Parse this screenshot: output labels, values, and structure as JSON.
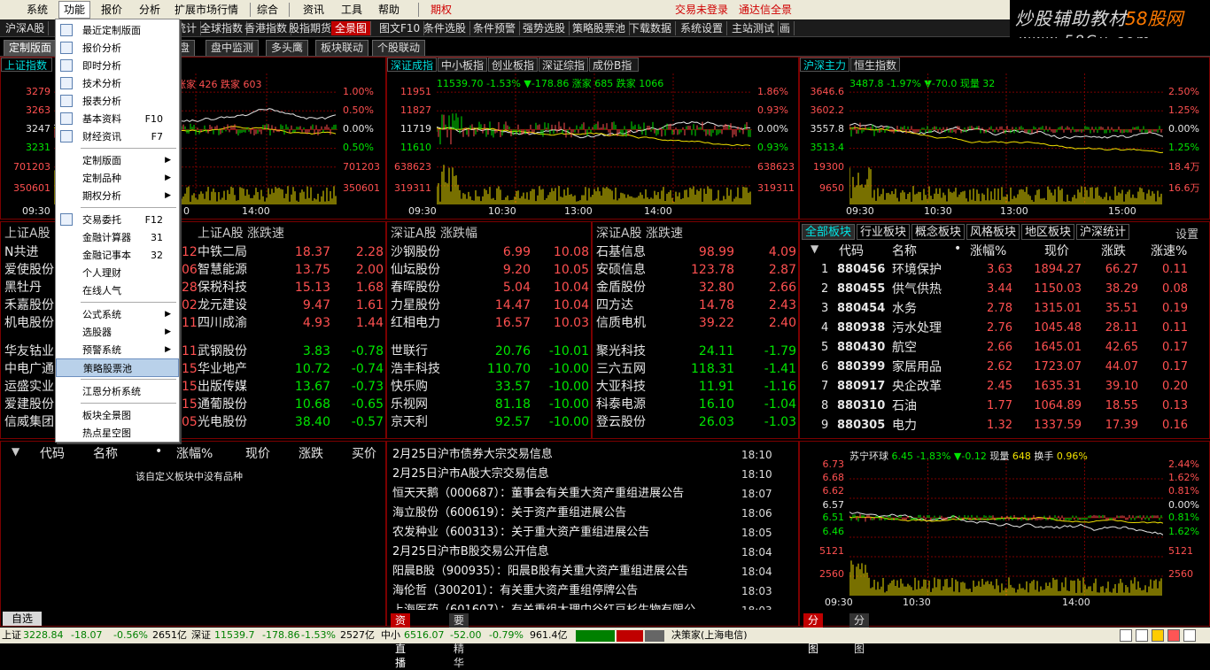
{
  "menubar": {
    "items": [
      "系统",
      "功能",
      "报价",
      "分析",
      "扩展市场行情",
      "综合",
      "资讯",
      "工具",
      "帮助",
      "期权"
    ],
    "login": "交易未登录",
    "broker": "通达信全景",
    "watermark_cn": "炒股辅助教材",
    "watermark_brand": "58股网",
    "watermark_url": "www.58Gu.com"
  },
  "tabrow1": [
    "沪深A股",
    "金博弈",
    "DDE排名",
    "区间统计",
    "全球指数",
    "香港指数",
    "股指期货",
    "全景图",
    "图文F10",
    "条件选股",
    "条件预警",
    "强势选股",
    "策略股票池",
    "下载数据",
    "系统设置",
    "主站测试",
    "画"
  ],
  "tabrow2": [
    "定制版面",
    "盘",
    "盘中监测",
    "多头鹰",
    "板块联动",
    "个股联动"
  ],
  "charts": {
    "sh": {
      "tab1": "上证指数",
      "stats": "涨家 426 跌家 603",
      "yl": [
        "3279",
        "3263",
        "3247",
        "3231",
        "701203",
        "350601"
      ],
      "yr": [
        "1.00%",
        "0.50%",
        "0.00%",
        "0.50%",
        "701203",
        "350601"
      ],
      "xt": [
        "09:30",
        "0",
        "14:00"
      ]
    },
    "sz": {
      "tabs": [
        "深证成指",
        "中小板指",
        "创业板指",
        "深证综指",
        "成份B指"
      ],
      "stats": "11539.70  -1.53%  ▼-178.86  涨家 685  跌家 1066",
      "yl": [
        "11951",
        "11827",
        "11719",
        "11610",
        "638623",
        "319311"
      ],
      "yr": [
        "1.86%",
        "0.93%",
        "0.00%",
        "0.93%",
        "638623",
        "319311"
      ],
      "xt": [
        "09:30",
        "10:30",
        "13:00",
        "14:00"
      ]
    },
    "hs": {
      "tabs": [
        "沪深主力",
        "恒生指数"
      ],
      "stats": "3487.8  -1.97%  ▼-70.0  现量 32",
      "yl": [
        "3646.6",
        "3602.2",
        "3557.8",
        "3513.4",
        "19300",
        "9650"
      ],
      "yr": [
        "2.50%",
        "1.25%",
        "0.00%",
        "1.25%",
        "18.4万",
        "16.6万"
      ],
      "xt": [
        "09:30",
        "10:30",
        "13:00",
        "15:00"
      ]
    }
  },
  "sh_rank": {
    "head_tab": "上证A股",
    "head2": "上证A股  涨跌速",
    "left_names": [
      "N共进",
      "爱使股份",
      "黑牡丹",
      "禾嘉股份",
      "机电股份",
      "华友钴业",
      "中电广通",
      "运盛实业",
      "爱建股份",
      "信威集团"
    ],
    "rows": [
      {
        "n": "中铁二局",
        "p": "18.37",
        "c": "2.28",
        "pre": "12"
      },
      {
        "n": "智慧能源",
        "p": "13.75",
        "c": "2.00",
        "pre": "06"
      },
      {
        "n": "保税科技",
        "p": "15.13",
        "c": "1.68",
        "pre": "28"
      },
      {
        "n": "龙元建设",
        "p": "9.47",
        "c": "1.61",
        "pre": "02"
      },
      {
        "n": "四川成渝",
        "p": "4.93",
        "c": "1.44",
        "pre": "11"
      },
      {
        "n": "武钢股份",
        "p": "3.83",
        "c": "-0.78",
        "pre": "11"
      },
      {
        "n": "华业地产",
        "p": "10.72",
        "c": "-0.74",
        "pre": "15"
      },
      {
        "n": "出版传媒",
        "p": "13.67",
        "c": "-0.73",
        "pre": "15"
      },
      {
        "n": "通葡股份",
        "p": "10.68",
        "c": "-0.65",
        "pre": "15"
      },
      {
        "n": "光电股份",
        "p": "38.40",
        "c": "-0.57",
        "pre": "05"
      }
    ]
  },
  "sz_rank1": {
    "head": "深证A股  涨跌幅",
    "rows": [
      {
        "n": "沙钢股份",
        "p": "6.99",
        "c": "10.08"
      },
      {
        "n": "仙坛股份",
        "p": "9.20",
        "c": "10.05"
      },
      {
        "n": "春晖股份",
        "p": "5.04",
        "c": "10.04"
      },
      {
        "n": "力星股份",
        "p": "14.47",
        "c": "10.04"
      },
      {
        "n": "红相电力",
        "p": "16.57",
        "c": "10.03"
      },
      {
        "n": "世联行",
        "p": "20.76",
        "c": "-10.01"
      },
      {
        "n": "浩丰科技",
        "p": "110.70",
        "c": "-10.00"
      },
      {
        "n": "快乐购",
        "p": "33.57",
        "c": "-10.00"
      },
      {
        "n": "乐视网",
        "p": "81.18",
        "c": "-10.00"
      },
      {
        "n": "京天利",
        "p": "92.57",
        "c": "-10.00"
      }
    ]
  },
  "sz_rank2": {
    "head": "深证A股  涨跌速",
    "rows": [
      {
        "n": "石基信息",
        "p": "98.99",
        "c": "4.09"
      },
      {
        "n": "安硕信息",
        "p": "123.78",
        "c": "2.87"
      },
      {
        "n": "金盾股份",
        "p": "32.80",
        "c": "2.66"
      },
      {
        "n": "四方达",
        "p": "14.78",
        "c": "2.43"
      },
      {
        "n": "信质电机",
        "p": "39.22",
        "c": "2.40"
      },
      {
        "n": "聚光科技",
        "p": "24.11",
        "c": "-1.79"
      },
      {
        "n": "三六五网",
        "p": "118.31",
        "c": "-1.41"
      },
      {
        "n": "大亚科技",
        "p": "11.91",
        "c": "-1.16"
      },
      {
        "n": "科泰电源",
        "p": "16.10",
        "c": "-1.04"
      },
      {
        "n": "登云股份",
        "p": "26.03",
        "c": "-1.03"
      }
    ]
  },
  "sector": {
    "tabs": [
      "全部板块",
      "行业板块",
      "概念板块",
      "风格板块",
      "地区板块",
      "沪深统计"
    ],
    "settings": "设置",
    "cols": [
      "代码",
      "名称",
      "•",
      "涨幅%",
      "现价",
      "涨跌",
      "涨速%"
    ],
    "rows": [
      {
        "i": "1",
        "code": "880456",
        "name": "环境保护",
        "chg": "3.63",
        "price": "1894.27",
        "diff": "66.27",
        "spd": "0.11"
      },
      {
        "i": "2",
        "code": "880455",
        "name": "供气供热",
        "chg": "3.44",
        "price": "1150.03",
        "diff": "38.29",
        "spd": "0.08"
      },
      {
        "i": "3",
        "code": "880454",
        "name": "水务",
        "chg": "2.78",
        "price": "1315.01",
        "diff": "35.51",
        "spd": "0.19"
      },
      {
        "i": "4",
        "code": "880938",
        "name": "污水处理",
        "chg": "2.76",
        "price": "1045.48",
        "diff": "28.11",
        "spd": "0.11"
      },
      {
        "i": "5",
        "code": "880430",
        "name": "航空",
        "chg": "2.66",
        "price": "1645.01",
        "diff": "42.65",
        "spd": "0.17"
      },
      {
        "i": "6",
        "code": "880399",
        "name": "家居用品",
        "chg": "2.62",
        "price": "1723.07",
        "diff": "44.07",
        "spd": "0.17"
      },
      {
        "i": "7",
        "code": "880917",
        "name": "央企改革",
        "chg": "2.45",
        "price": "1635.31",
        "diff": "39.10",
        "spd": "0.20"
      },
      {
        "i": "8",
        "code": "880310",
        "name": "石油",
        "chg": "1.77",
        "price": "1064.89",
        "diff": "18.55",
        "spd": "0.13"
      },
      {
        "i": "9",
        "code": "880305",
        "name": "电力",
        "chg": "1.32",
        "price": "1337.59",
        "diff": "17.39",
        "spd": "0.16"
      }
    ]
  },
  "custom": {
    "cols": [
      "代码",
      "名称",
      "•",
      "涨幅%",
      "现价",
      "涨跌",
      "买价"
    ],
    "empty": "该自定义板块中没有品种",
    "tab": "自选"
  },
  "news": {
    "items": [
      {
        "t": "2月25日沪市债券大宗交易信息",
        "tm": "18:10"
      },
      {
        "t": "2月25日沪市A股大宗交易信息",
        "tm": "18:10"
      },
      {
        "t": "恒天天鹅（000687）：董事会有关重大资产重组进展公告",
        "tm": "18:07"
      },
      {
        "t": "海立股份（600619）：关于资产重组进展公告",
        "tm": "18:06"
      },
      {
        "t": "农发种业（600313）：关于重大资产重组进展公告",
        "tm": "18:05"
      },
      {
        "t": "2月25日沪市B股交易公开信息",
        "tm": "18:04"
      },
      {
        "t": "阳晨B股（900935）：阳晨B股有关重大资产重组进展公告",
        "tm": "18:04"
      },
      {
        "t": "海伦哲（300201）：有关重大资产重组停牌公告",
        "tm": "18:03"
      },
      {
        "t": "上海医药（601607）：有关重组大理中谷红豆杉生物有限公",
        "tm": "18:03"
      }
    ],
    "tabs": [
      "资讯直播",
      "要闻精华"
    ]
  },
  "stock": {
    "name": "苏宁环球",
    "price": "6.45",
    "pct": "-1.83%",
    "chg": "▼-0.12",
    "vol_label": "现量",
    "vol": "648",
    "turn_label": "换手",
    "turn": "0.96%",
    "yl": [
      "6.73",
      "6.68",
      "6.62",
      "6.57",
      "6.51",
      "6.46",
      "5121",
      "2560"
    ],
    "yr": [
      "2.44%",
      "1.62%",
      "0.81%",
      "0.00%",
      "0.81%",
      "1.62%",
      "5121",
      "2560"
    ],
    "xt": [
      "09:30",
      "10:30",
      "14:00"
    ],
    "tabs": [
      "分时图",
      "分析图"
    ]
  },
  "menu": {
    "items": [
      {
        "l": "最近定制版面",
        "ico": 1
      },
      {
        "l": "报价分析",
        "ico": 1
      },
      {
        "l": "即时分析",
        "ico": 1
      },
      {
        "l": "技术分析",
        "ico": 1
      },
      {
        "l": "报表分析",
        "ico": 1
      },
      {
        "l": "基本资料",
        "k": "F10",
        "ico": 1
      },
      {
        "l": "财经资讯",
        "k": "F7",
        "ico": 1
      },
      {
        "sep": 1
      },
      {
        "l": "定制版面",
        "a": 1
      },
      {
        "l": "定制品种",
        "a": 1
      },
      {
        "l": "期权分析",
        "a": 1
      },
      {
        "sep": 1
      },
      {
        "l": "交易委托",
        "k": "F12",
        "ico": 1
      },
      {
        "l": "金融计算器",
        "k": "31"
      },
      {
        "l": "金融记事本",
        "k": "32"
      },
      {
        "l": "个人理财"
      },
      {
        "l": "在线人气"
      },
      {
        "sep": 1
      },
      {
        "l": "公式系统",
        "a": 1
      },
      {
        "l": "选股器",
        "a": 1
      },
      {
        "l": "预警系统",
        "a": 1
      },
      {
        "l": "策略股票池",
        "hl": 1
      },
      {
        "sep": 1
      },
      {
        "l": "江恩分析系统"
      },
      {
        "sep": 1
      },
      {
        "l": "板块全景图"
      },
      {
        "l": "热点星空图"
      }
    ]
  },
  "status": {
    "sh_l": "上证",
    "sh_v": "3228.84",
    "sh_c": "-18.07",
    "sh_p": "-0.56%",
    "sh_a": "2651亿",
    "sz_l": "深证",
    "sz_v": "11539.7",
    "sz_c": "-178.86",
    "sz_p": "-1.53%",
    "sz_a": "2527亿",
    "zx_l": "中小",
    "zx_v": "6516.07",
    "zx_c": "-52.00",
    "zx_p": "-0.79%",
    "zx_a": "961.4亿",
    "server": "决策家(上海电信)"
  },
  "colors": {
    "up": "#ff5050",
    "down": "#00e600",
    "grid": "#7a0000",
    "bg": "#000000",
    "flat": "#e6e6e6"
  }
}
